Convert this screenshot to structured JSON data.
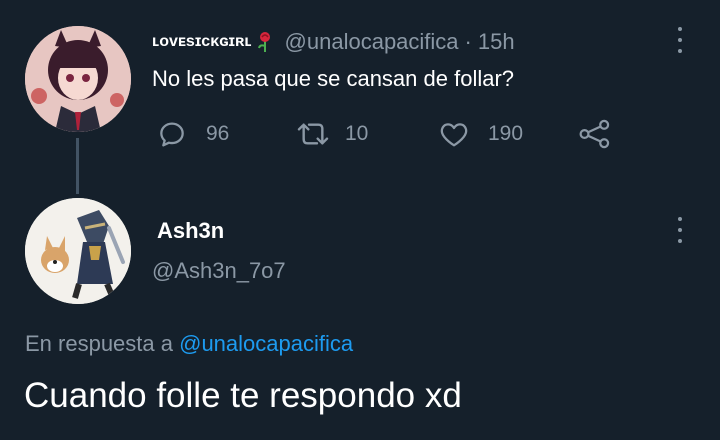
{
  "parent_tweet": {
    "display_name": "ʟᴏᴠᴇsɪᴄᴋɢɪʀʟ",
    "handle": "@unalocapacifica",
    "separator": "·",
    "time": "15h",
    "text": "No les pasa que se cansan de follar?",
    "actions": {
      "reply_count": "96",
      "retweet_count": "10",
      "like_count": "190"
    }
  },
  "reply_tweet": {
    "display_name": "Ash3n",
    "handle": "@Ash3n_7o7",
    "replying_to_prefix": "En respuesta a",
    "replying_to_handle": "@unalocapacifica",
    "text": "Cuando folle te respondo xd"
  },
  "colors": {
    "background": "#15202b",
    "text": "#ffffff",
    "muted": "#8b98a5",
    "link": "#1d9bf0",
    "thread_line": "#425364"
  },
  "icons": [
    "more-icon",
    "reply-icon",
    "retweet-icon",
    "like-icon",
    "share-icon",
    "rose-emoji-icon"
  ]
}
